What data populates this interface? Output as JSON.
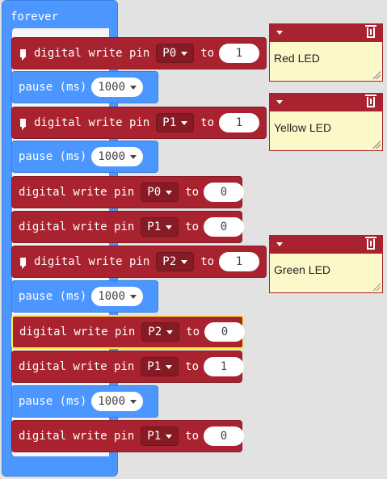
{
  "workspace": {
    "forever_label": "forever",
    "blocks": [
      {
        "type": "digital_write",
        "label": "digital write pin",
        "pin": "P0",
        "to_label": "to",
        "value": "1",
        "has_comment": true
      },
      {
        "type": "pause",
        "label": "pause (ms)",
        "value": "1000"
      },
      {
        "type": "digital_write",
        "label": "digital write pin",
        "pin": "P1",
        "to_label": "to",
        "value": "1",
        "has_comment": true
      },
      {
        "type": "pause",
        "label": "pause (ms)",
        "value": "1000"
      },
      {
        "type": "digital_write",
        "label": "digital write pin",
        "pin": "P0",
        "to_label": "to",
        "value": "0"
      },
      {
        "type": "digital_write",
        "label": "digital write pin",
        "pin": "P1",
        "to_label": "to",
        "value": "0"
      },
      {
        "type": "digital_write",
        "label": "digital write pin",
        "pin": "P2",
        "to_label": "to",
        "value": "1",
        "has_comment": true
      },
      {
        "type": "pause",
        "label": "pause (ms)",
        "value": "1000"
      },
      {
        "type": "digital_write",
        "label": "digital write pin",
        "pin": "P2",
        "to_label": "to",
        "value": "0",
        "selected": true
      },
      {
        "type": "digital_write",
        "label": "digital write pin",
        "pin": "P1",
        "to_label": "to",
        "value": "1"
      },
      {
        "type": "pause",
        "label": "pause (ms)",
        "value": "1000"
      },
      {
        "type": "digital_write",
        "label": "digital write pin",
        "pin": "P1",
        "to_label": "to",
        "value": "0"
      }
    ],
    "comments": [
      {
        "text": "Red LED"
      },
      {
        "text": "Yellow LED"
      },
      {
        "text": "Green LED"
      }
    ]
  },
  "colors": {
    "forever_blue": "#4c97ff",
    "pins_red": "#a8232f",
    "comment_yellow": "#fdf8c8",
    "selection": "#ffeb3b"
  }
}
